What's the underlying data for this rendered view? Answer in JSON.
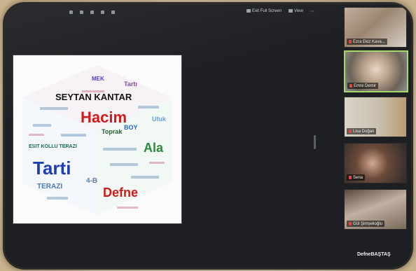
{
  "toolbar": {
    "icons": [
      "layout-icon",
      "info-icon",
      "record-icon",
      "view-icon",
      "security-icon"
    ],
    "exit_full_screen_label": "Exit Full Screen",
    "view_label": "View"
  },
  "shared_screen": {
    "word_cloud_words": [
      "SEYTAN KANTAR",
      "Hacim",
      "Tarti",
      "Defne",
      "Ala",
      "TERAZI",
      "BOY",
      "4-B",
      "Toprak",
      "Ufuk",
      "ESIT KOLLU TERAZI",
      "MEK",
      "Tartı"
    ]
  },
  "participants": [
    {
      "name": "Ezra Ekiz Kava...",
      "active": false
    },
    {
      "name": "Emre Demir",
      "active": true
    },
    {
      "name": "Lisa Doğan",
      "active": false
    },
    {
      "name": "Sena",
      "active": false
    },
    {
      "name": "Gül Şimşekoğlu",
      "active": false
    }
  ],
  "self_name": "DefneBAŞTAŞ"
}
